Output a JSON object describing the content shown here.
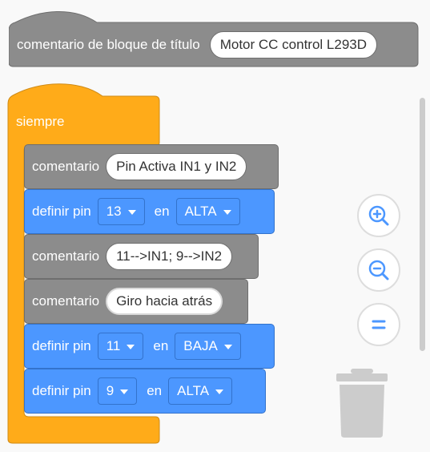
{
  "title_block": {
    "label": "comentario de bloque de título",
    "value": "Motor CC control L293D"
  },
  "forever_block": {
    "label": "siempre"
  },
  "blocks": [
    {
      "type": "comment",
      "label": "comentario",
      "value": "Pin Activa IN1 y IN2"
    },
    {
      "type": "set_pin",
      "label": "definir pin",
      "pin": "13",
      "en": "en",
      "state": "ALTA"
    },
    {
      "type": "comment",
      "label": "comentario",
      "value": "11-->IN1; 9-->IN2"
    },
    {
      "type": "comment",
      "label": "comentario",
      "value": "Giro hacia atrás"
    },
    {
      "type": "set_pin",
      "label": "definir pin",
      "pin": "11",
      "en": "en",
      "state": "BAJA"
    },
    {
      "type": "set_pin",
      "label": "definir pin",
      "pin": "9",
      "en": "en",
      "state": "ALTA"
    }
  ],
  "controls": {
    "zoom_in_icon": "zoom-in-icon",
    "zoom_out_icon": "zoom-out-icon",
    "reset_zoom_icon": "equals-icon",
    "trash_icon": "trash-icon"
  },
  "colors": {
    "comment_block": "#8c8c8c",
    "pin_block": "#4c97ff",
    "control_block": "#ffab19",
    "background": "#f9f9f9"
  }
}
